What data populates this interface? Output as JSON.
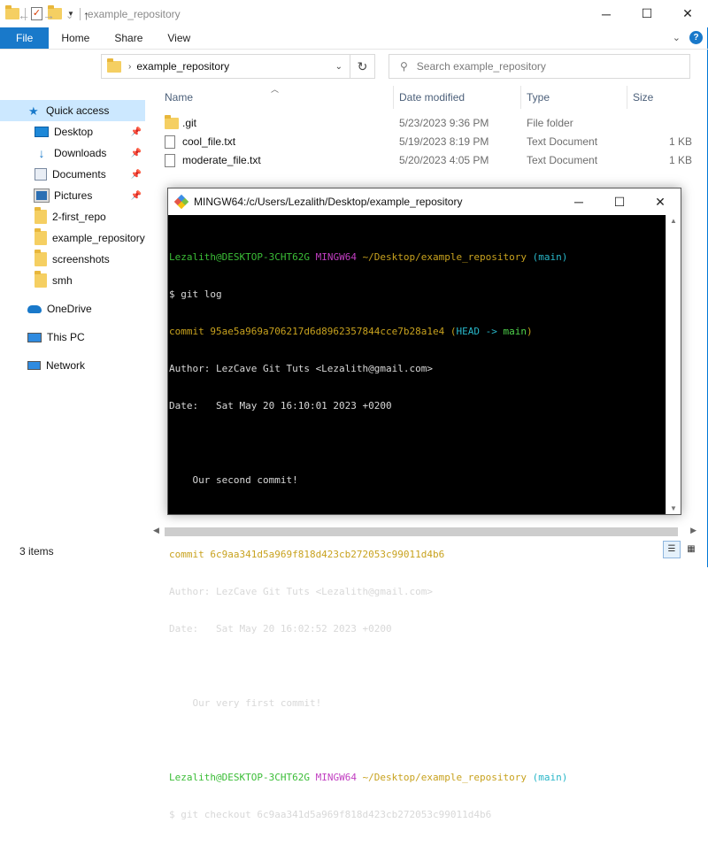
{
  "window": {
    "title": "example_repository",
    "controls": {
      "minimize": "─",
      "maximize": "☐",
      "close": "✕"
    }
  },
  "ribbon": {
    "tabs": [
      "File",
      "Home",
      "Share",
      "View"
    ],
    "expand_icon": "chevron-down-icon",
    "help": "?"
  },
  "navigation": {
    "back": "←",
    "forward": "→",
    "recent": "⌄",
    "up": "↑",
    "address_path": "example_repository",
    "refresh": "↻",
    "search_placeholder": "Search example_repository"
  },
  "sidebar": {
    "items": [
      {
        "label": "Quick access",
        "icon": "star-icon",
        "selected": true
      },
      {
        "label": "Desktop",
        "icon": "desktop-icon",
        "pinned": true
      },
      {
        "label": "Downloads",
        "icon": "download-icon",
        "pinned": true
      },
      {
        "label": "Documents",
        "icon": "documents-icon",
        "pinned": true
      },
      {
        "label": "Pictures",
        "icon": "pictures-icon",
        "pinned": true
      },
      {
        "label": "2-first_repo",
        "icon": "folder-icon"
      },
      {
        "label": "example_repository",
        "icon": "folder-icon"
      },
      {
        "label": "screenshots",
        "icon": "folder-icon"
      },
      {
        "label": "smh",
        "icon": "folder-icon"
      },
      {
        "label": "OneDrive",
        "icon": "cloud-icon"
      },
      {
        "label": "This PC",
        "icon": "computer-icon"
      },
      {
        "label": "Network",
        "icon": "network-icon"
      }
    ]
  },
  "columns": {
    "name": "Name",
    "date": "Date modified",
    "type": "Type",
    "size": "Size"
  },
  "files": [
    {
      "name": ".git",
      "date": "5/23/2023 9:36 PM",
      "type": "File folder",
      "size": "",
      "icon": "folder-icon"
    },
    {
      "name": "cool_file.txt",
      "date": "5/19/2023 8:19 PM",
      "type": "Text Document",
      "size": "1 KB",
      "icon": "text-file-icon"
    },
    {
      "name": "moderate_file.txt",
      "date": "5/20/2023 4:05 PM",
      "type": "Text Document",
      "size": "1 KB",
      "icon": "text-file-icon"
    }
  ],
  "status": {
    "item_count": "3 items"
  },
  "terminal": {
    "title": "MINGW64:/c/Users/Lezalith/Desktop/example_repository",
    "prompt1": {
      "user": "Lezalith@DESKTOP-3CHT62G",
      "env": "MINGW64",
      "path": "~/Desktop/example_repository",
      "branch": "(main)"
    },
    "cmd1": "$ git log",
    "commit1": {
      "label": "commit 95ae5a969a706217d6d8962357844cce7b28a1e4",
      "open": "(",
      "head": "HEAD ->",
      "branch": "main",
      "close": ")"
    },
    "author1": "Author: LezCave Git Tuts <Lezalith@gmail.com>",
    "date1": "Date:   Sat May 20 16:10:01 2023 +0200",
    "msg1": "    Our second commit!",
    "commit2": "commit 6c9aa341d5a969f818d423cb272053c99011d4b6",
    "author2": "Author: LezCave Git Tuts <Lezalith@gmail.com>",
    "date2": "Date:   Sat May 20 16:02:52 2023 +0200",
    "msg2": "    Our very first commit!",
    "prompt2": {
      "user": "Lezalith@DESKTOP-3CHT62G",
      "env": "MINGW64",
      "path": "~/Desktop/example_repository",
      "branch": "(main)"
    },
    "cmd2": "$ git checkout 6c9aa341d5a969f818d423cb272053c99011d4b6"
  },
  "colors": {
    "file_tab": "#1979ca",
    "selection": "#cce8ff",
    "prompt_user": "#3bbd37",
    "prompt_env": "#c13ec1",
    "prompt_path": "#c8a21e",
    "prompt_branch": "#28b6c8"
  }
}
